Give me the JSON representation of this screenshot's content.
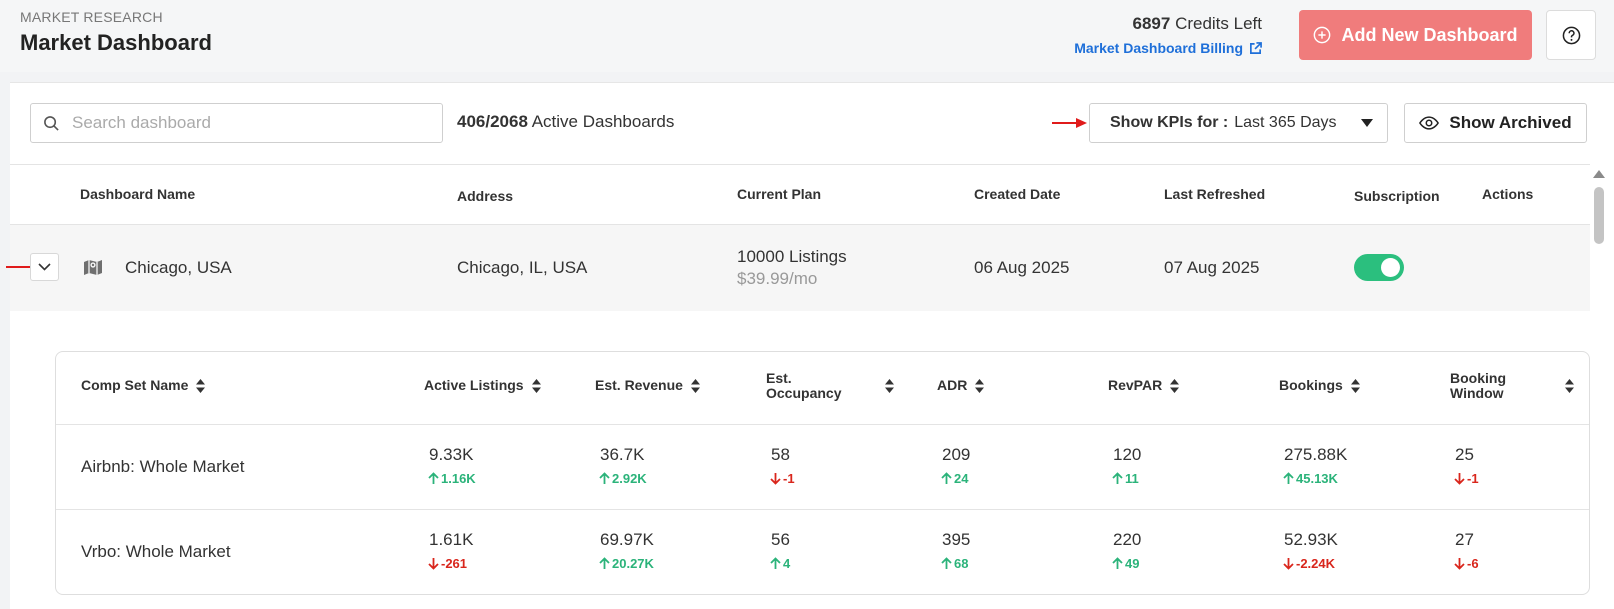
{
  "header": {
    "eyebrow": "MARKET RESEARCH",
    "title": "Market Dashboard",
    "credits_value": "6897",
    "credits_label": "Credits Left",
    "billing_link": "Market Dashboard Billing",
    "add_button": "Add New Dashboard"
  },
  "toolbar": {
    "search_placeholder": "Search dashboard",
    "active_count": "406/2068",
    "active_label": "Active Dashboards",
    "kpi_label": "Show KPIs for :",
    "kpi_value": "Last 365 Days",
    "archived_button": "Show Archived"
  },
  "table": {
    "columns": [
      "Dashboard Name",
      "Address",
      "Current Plan",
      "Created Date",
      "Last Refreshed",
      "Subscription",
      "Actions"
    ],
    "row": {
      "name": "Chicago, USA",
      "address": "Chicago, IL, USA",
      "plan": "10000 Listings",
      "plan_price": "$39.99/mo",
      "created": "06 Aug 2025",
      "refreshed": "07 Aug 2025",
      "subscription_on": true
    }
  },
  "compset": {
    "columns": [
      "Comp Set Name",
      "Active Listings",
      "Est. Revenue",
      "Est. Occupancy",
      "ADR",
      "RevPAR",
      "Bookings",
      "Booking Window"
    ],
    "rows": [
      {
        "name": "Airbnb: Whole Market",
        "cells": [
          {
            "value": "9.33K",
            "delta": "1.16K",
            "dir": "up"
          },
          {
            "value": "36.7K",
            "delta": "2.92K",
            "dir": "up"
          },
          {
            "value": "58",
            "delta": "-1",
            "dir": "down"
          },
          {
            "value": "209",
            "delta": "24",
            "dir": "up"
          },
          {
            "value": "120",
            "delta": "11",
            "dir": "up"
          },
          {
            "value": "275.88K",
            "delta": "45.13K",
            "dir": "up"
          },
          {
            "value": "25",
            "delta": "-1",
            "dir": "down"
          }
        ]
      },
      {
        "name": "Vrbo: Whole Market",
        "cells": [
          {
            "value": "1.61K",
            "delta": "-261",
            "dir": "down"
          },
          {
            "value": "69.97K",
            "delta": "20.27K",
            "dir": "up"
          },
          {
            "value": "56",
            "delta": "4",
            "dir": "up"
          },
          {
            "value": "395",
            "delta": "68",
            "dir": "up"
          },
          {
            "value": "220",
            "delta": "49",
            "dir": "up"
          },
          {
            "value": "52.93K",
            "delta": "-2.24K",
            "dir": "down"
          },
          {
            "value": "27",
            "delta": "-6",
            "dir": "down"
          }
        ]
      }
    ]
  },
  "colors": {
    "accent": "#f07c7c",
    "link": "#1e6fd9",
    "up": "#2bb37a",
    "down": "#d9261c",
    "toggle": "#2bbf7e"
  }
}
